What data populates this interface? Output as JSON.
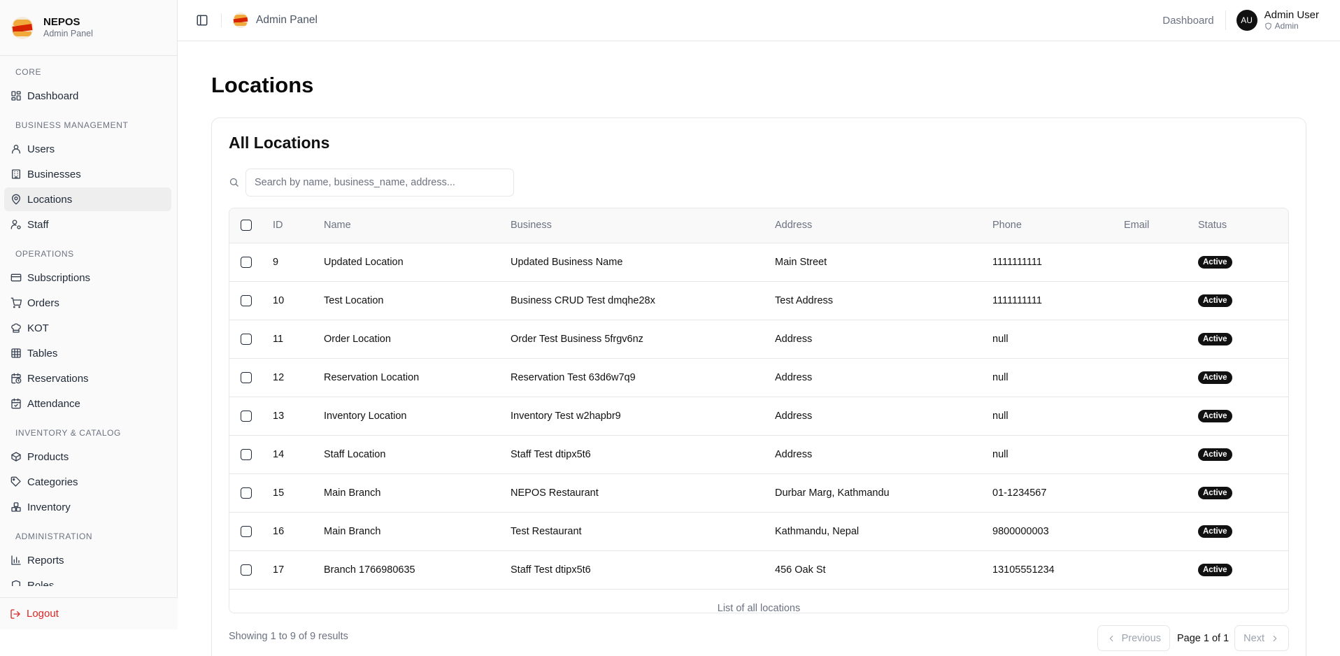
{
  "brand": {
    "name": "NEPOS",
    "subtitle": "Admin Panel"
  },
  "header": {
    "title": "Admin Panel",
    "dashboard_link": "Dashboard",
    "user": {
      "initials": "AU",
      "name": "Admin User",
      "role": "Admin"
    }
  },
  "sidebar": {
    "groups": [
      {
        "title": "CORE",
        "items": [
          {
            "label": "Dashboard",
            "icon": "dashboard-icon"
          }
        ]
      },
      {
        "title": "BUSINESS MANAGEMENT",
        "items": [
          {
            "label": "Users",
            "icon": "users-icon"
          },
          {
            "label": "Businesses",
            "icon": "building-icon"
          },
          {
            "label": "Locations",
            "icon": "map-pin-icon",
            "active": true
          },
          {
            "label": "Staff",
            "icon": "staff-icon"
          }
        ]
      },
      {
        "title": "OPERATIONS",
        "items": [
          {
            "label": "Subscriptions",
            "icon": "credit-card-icon"
          },
          {
            "label": "Orders",
            "icon": "cart-icon"
          },
          {
            "label": "KOT",
            "icon": "chef-hat-icon"
          },
          {
            "label": "Tables",
            "icon": "table-icon"
          },
          {
            "label": "Reservations",
            "icon": "calendar-clock-icon"
          },
          {
            "label": "Attendance",
            "icon": "calendar-check-icon"
          }
        ]
      },
      {
        "title": "INVENTORY & CATALOG",
        "items": [
          {
            "label": "Products",
            "icon": "package-icon"
          },
          {
            "label": "Categories",
            "icon": "tags-icon"
          },
          {
            "label": "Inventory",
            "icon": "boxes-icon"
          }
        ]
      },
      {
        "title": "ADMINISTRATION",
        "items": [
          {
            "label": "Reports",
            "icon": "bar-chart-icon"
          },
          {
            "label": "Roles",
            "icon": "shield-icon"
          }
        ]
      }
    ],
    "logout": "Logout"
  },
  "main": {
    "page_title": "Locations",
    "card_title": "All Locations",
    "search": {
      "placeholder": "Search by name, business_name, address...",
      "value": ""
    },
    "table": {
      "headers": [
        "ID",
        "Name",
        "Business",
        "Address",
        "Phone",
        "Email",
        "Status"
      ],
      "rows": [
        {
          "id": "9",
          "name": "Updated Location",
          "business": "Updated Business Name",
          "address": "Main Street",
          "phone": "1111111111",
          "email": "",
          "status": "Active"
        },
        {
          "id": "10",
          "name": "Test Location",
          "business": "Business CRUD Test dmqhe28x",
          "address": "Test Address",
          "phone": "1111111111",
          "email": "",
          "status": "Active"
        },
        {
          "id": "11",
          "name": "Order Location",
          "business": "Order Test Business 5frgv6nz",
          "address": "Address",
          "phone": "null",
          "email": "",
          "status": "Active"
        },
        {
          "id": "12",
          "name": "Reservation Location",
          "business": "Reservation Test 63d6w7q9",
          "address": "Address",
          "phone": "null",
          "email": "",
          "status": "Active"
        },
        {
          "id": "13",
          "name": "Inventory Location",
          "business": "Inventory Test w2hapbr9",
          "address": "Address",
          "phone": "null",
          "email": "",
          "status": "Active"
        },
        {
          "id": "14",
          "name": "Staff Location",
          "business": "Staff Test dtipx5t6",
          "address": "Address",
          "phone": "null",
          "email": "",
          "status": "Active"
        },
        {
          "id": "15",
          "name": "Main Branch",
          "business": "NEPOS Restaurant",
          "address": "Durbar Marg, Kathmandu",
          "phone": "01-1234567",
          "email": "",
          "status": "Active"
        },
        {
          "id": "16",
          "name": "Main Branch",
          "business": "Test Restaurant",
          "address": "Kathmandu, Nepal",
          "phone": "9800000003",
          "email": "",
          "status": "Active"
        },
        {
          "id": "17",
          "name": "Branch 1766980635",
          "business": "Staff Test dtipx5t6",
          "address": "456 Oak St",
          "phone": "13105551234",
          "email": "",
          "status": "Active"
        }
      ],
      "caption": "List of all locations"
    },
    "pagination": {
      "showing": "Showing 1 to 9 of 9 results",
      "previous": "Previous",
      "page_text": "Page 1 of 1",
      "next": "Next"
    }
  },
  "colors": {
    "accent": "#111111",
    "logout": "#dc2626",
    "active_bg": "#eeeeef",
    "border": "#e5e7eb"
  }
}
